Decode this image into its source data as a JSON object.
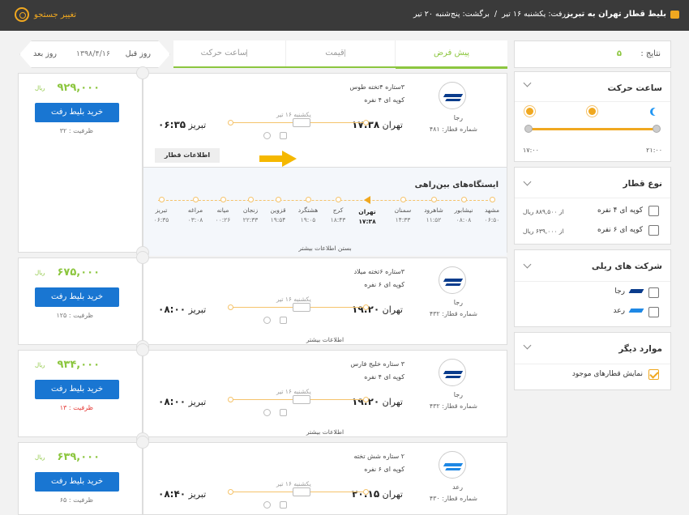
{
  "header": {
    "route": "بلیط قطار تهران به تبریز",
    "depart_label": "رفت: یکشنبه ۱۶ تیر",
    "separator": "/",
    "return_label": "برگشت: پنج‌شنبه ۲۰ تیر",
    "change_search": "تغییر جستجو",
    "colors": {
      "bar": "#3a3a3a",
      "accent": "#f0a820"
    }
  },
  "results": {
    "label": "نتایج :",
    "count": "۵"
  },
  "sort": {
    "tabs": [
      {
        "label": "پیش فرض",
        "active": true
      },
      {
        "label": "قیمت",
        "active": false
      },
      {
        "label": "ساعت حرکت",
        "active": false
      }
    ]
  },
  "daynav": {
    "prev": "روز قبل",
    "date": "۱۳۹۸/۴/۱۶",
    "next": "روز بعد"
  },
  "filters": {
    "time": {
      "title": "ساعت حرکت",
      "from": "۲۱:۰۰",
      "to": "۱۷:۰۰"
    },
    "train_type": {
      "title": "نوع قطار",
      "options": [
        {
          "label": "کوپه ای ۴ نفره",
          "price": "از ۸۸۹,۵۰۰ ریال"
        },
        {
          "label": "کوپه ای ۶ نفره",
          "price": "از ۶۳۹,۰۰۰ ریال"
        }
      ]
    },
    "companies": {
      "title": "شرکت های ریلی",
      "options": [
        {
          "label": "رجا"
        },
        {
          "label": "رعد"
        }
      ]
    },
    "other": {
      "title": "موارد دیگر",
      "options": [
        {
          "label": "نمایش قطارهای موجود",
          "checked": true
        }
      ]
    }
  },
  "trains": [
    {
      "price": "۹۲۹,۰۰۰",
      "currency": "ریال",
      "buy": "خرید بلیط رفت",
      "capacity": "ظرفیت : ۳۲",
      "wagon": "۳ستاره ۴تخته طوس",
      "compartment": "کوپه ای ۴ نفره",
      "company": "رجا",
      "train_no": "شماره قطار: ۴۸۱",
      "from": "تهران",
      "dep_time": "۱۷:۳۸",
      "to": "تبریز",
      "arr_time": "۰۶:۳۵",
      "date": "یکشنبه ۱۶ تیر",
      "info_badge": "اطلاعات قطار",
      "stations_title": "ایستگاه‌های بین‌راهی",
      "stations": [
        {
          "name": "مشهد",
          "time": "۰۶:۵۰"
        },
        {
          "name": "نیشابور",
          "time": "۰۸:۰۸"
        },
        {
          "name": "شاهرود",
          "time": "۱۱:۵۲"
        },
        {
          "name": "سمنان",
          "time": "۱۴:۳۳"
        },
        {
          "name": "تهران",
          "time": "۱۷:۳۸",
          "current": true
        },
        {
          "name": "کرج",
          "time": "۱۸:۴۳"
        },
        {
          "name": "هشتگرد",
          "time": "۱۹:۰۵"
        },
        {
          "name": "قزوین",
          "time": "۱۹:۵۴"
        },
        {
          "name": "زنجان",
          "time": "۲۲:۳۳"
        },
        {
          "name": "میانه",
          "time": "۰۰:۲۶"
        },
        {
          "name": "مراغه",
          "time": "۰۳:۰۸"
        },
        {
          "name": "تبریز",
          "time": "۰۶:۳۵"
        }
      ],
      "more": "بستن اطلاعات بیشتر"
    },
    {
      "price": "۶۷۵,۰۰۰",
      "currency": "ریال",
      "buy": "خرید بلیط رفت",
      "capacity": "ظرفیت : ۱۲۵",
      "wagon": "۳ستاره ۶تخته میلاد",
      "compartment": "کوپه ای ۶ نفره",
      "company": "رجا",
      "train_no": "شماره قطار: ۴۳۲",
      "from": "تهران",
      "dep_time": "۱۹:۲۰",
      "to": "تبریز",
      "arr_time": "۰۸:۰۰",
      "date": "یکشنبه ۱۶ تیر",
      "more": "اطلاعات بیشتر"
    },
    {
      "price": "۹۳۴,۰۰۰",
      "currency": "ریال",
      "buy": "خرید بلیط رفت",
      "capacity": "ظرفیت : ۱۳",
      "capacity_red": true,
      "wagon": "۳ ستاره خلیج فارس",
      "compartment": "کوپه ای ۴ نفره",
      "company": "رجا",
      "train_no": "شماره قطار: ۴۳۲",
      "from": "تهران",
      "dep_time": "۱۹:۲۰",
      "to": "تبریز",
      "arr_time": "۰۸:۰۰",
      "date": "یکشنبه ۱۶ تیر",
      "more": "اطلاعات بیشتر"
    },
    {
      "price": "۶۳۹,۰۰۰",
      "currency": "ریال",
      "buy": "خرید بلیط رفت",
      "capacity": "ظرفیت : ۶۵",
      "wagon": "۲ ستاره شش تخته",
      "compartment": "کوپه ای ۶ نفره",
      "company": "رعد",
      "train_no": "شماره قطار: ۴۳۰",
      "from": "تهران",
      "dep_time": "۲۰:۱۵",
      "to": "تبریز",
      "arr_time": "۰۸:۴۰",
      "date": "یکشنبه ۱۶ تیر"
    }
  ]
}
